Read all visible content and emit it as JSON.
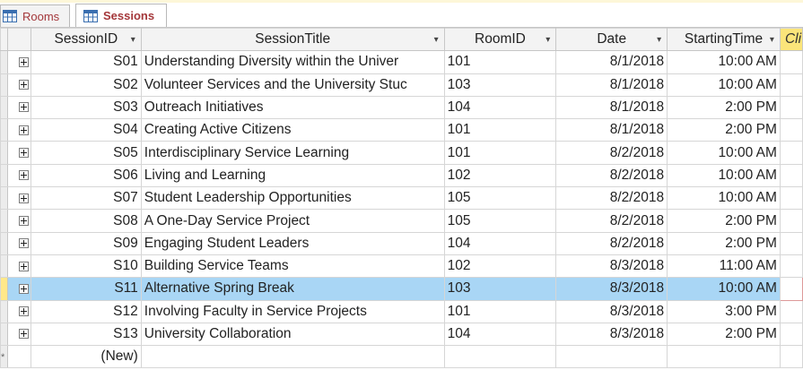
{
  "tabs": [
    {
      "label": "Rooms"
    },
    {
      "label": "Sessions"
    }
  ],
  "columns": [
    "SessionID",
    "SessionTitle",
    "RoomID",
    "Date",
    "StartingTime",
    "Cli"
  ],
  "rows": [
    {
      "id": "S01",
      "title": "Understanding Diversity within the Univer",
      "room": "101",
      "date": "8/1/2018",
      "time": "10:00 AM"
    },
    {
      "id": "S02",
      "title": "Volunteer Services and the University Stuc",
      "room": "103",
      "date": "8/1/2018",
      "time": "10:00 AM"
    },
    {
      "id": "S03",
      "title": "Outreach Initiatives",
      "room": "104",
      "date": "8/1/2018",
      "time": "2:00 PM"
    },
    {
      "id": "S04",
      "title": "Creating Active Citizens",
      "room": "101",
      "date": "8/1/2018",
      "time": "2:00 PM"
    },
    {
      "id": "S05",
      "title": "Interdisciplinary Service Learning",
      "room": "101",
      "date": "8/2/2018",
      "time": "10:00 AM"
    },
    {
      "id": "S06",
      "title": "Living and Learning",
      "room": "102",
      "date": "8/2/2018",
      "time": "10:00 AM"
    },
    {
      "id": "S07",
      "title": "Student Leadership Opportunities",
      "room": "105",
      "date": "8/2/2018",
      "time": "10:00 AM"
    },
    {
      "id": "S08",
      "title": "A One-Day Service Project",
      "room": "105",
      "date": "8/2/2018",
      "time": "2:00 PM"
    },
    {
      "id": "S09",
      "title": "Engaging Student Leaders",
      "room": "104",
      "date": "8/2/2018",
      "time": "2:00 PM"
    },
    {
      "id": "S10",
      "title": "Building Service Teams",
      "room": "102",
      "date": "8/3/2018",
      "time": "11:00 AM"
    },
    {
      "id": "S11",
      "title": "Alternative Spring Break",
      "room": "103",
      "date": "8/3/2018",
      "time": "10:00 AM"
    },
    {
      "id": "S12",
      "title": "Involving Faculty in Service Projects",
      "room": "101",
      "date": "8/3/2018",
      "time": "3:00 PM"
    },
    {
      "id": "S13",
      "title": "University Collaboration",
      "room": "104",
      "date": "8/3/2018",
      "time": "2:00 PM"
    }
  ],
  "new_row_label": "(New)",
  "new_row_marker": "*",
  "dropdown_glyph": "▾",
  "colors": {
    "selected_row": "#a9d6f5",
    "current_selector": "#ffe88a",
    "tab_text": "#a4373a"
  }
}
